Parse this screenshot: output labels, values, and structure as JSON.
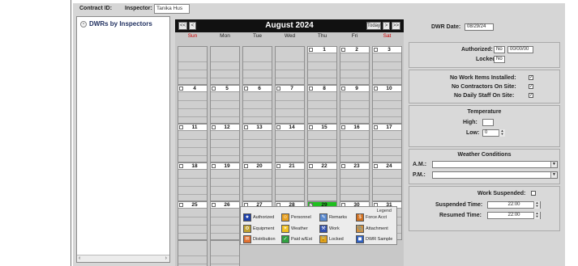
{
  "header": {
    "contract_label": "Contract ID:",
    "inspector_label": "Inspector:",
    "inspector_value": "Tanika Hus"
  },
  "tree": {
    "item_label": "DWRs by Inspectors",
    "toggle": "-"
  },
  "calendar": {
    "title": "August 2024",
    "prev_year": "<<",
    "prev_month": "<",
    "today": "Today",
    "next_month": ">",
    "next_year": ">>",
    "weekdays": [
      "Sun",
      "Mon",
      "Tue",
      "Wed",
      "Thu",
      "Fri",
      "Sat"
    ],
    "weeks": [
      [
        "",
        "",
        "",
        "",
        "1",
        "2",
        "3"
      ],
      [
        "4",
        "5",
        "6",
        "7",
        "8",
        "9",
        "10"
      ],
      [
        "11",
        "12",
        "13",
        "14",
        "15",
        "16",
        "17"
      ],
      [
        "18",
        "19",
        "20",
        "21",
        "22",
        "23",
        "24"
      ],
      [
        "25",
        "26",
        "27",
        "28",
        "29",
        "30",
        "31"
      ],
      [
        "",
        "",
        "",
        "",
        "",
        "",
        ""
      ]
    ],
    "selected_day": "29",
    "checkmark": "✓"
  },
  "legend": {
    "title": "Legend",
    "items": [
      {
        "label": "Authorized",
        "icon": "authorized-icon",
        "color": "#1c3fa8"
      },
      {
        "label": "Personnel",
        "icon": "personnel-icon",
        "color": "#e8a020"
      },
      {
        "label": "Remarks",
        "icon": "remarks-icon",
        "color": "#5a8ad0"
      },
      {
        "label": "Force Acct",
        "icon": "force-acct-icon",
        "color": "#d07020"
      },
      {
        "label": "Equipment",
        "icon": "equipment-icon",
        "color": "#c0a030"
      },
      {
        "label": "Weather",
        "icon": "weather-icon",
        "color": "#f0c020"
      },
      {
        "label": "Work",
        "icon": "work-icon",
        "color": "#3050b0"
      },
      {
        "label": "Attachment",
        "icon": "attachment-icon",
        "color": "#d09040"
      },
      {
        "label": "Distribution",
        "icon": "distribution-icon",
        "color": "#e07030"
      },
      {
        "label": "Paid w/Est",
        "icon": "paid-icon",
        "color": "#30a040"
      },
      {
        "label": "Locked",
        "icon": "lock-icon",
        "color": "#e0a020"
      },
      {
        "label": "DWR Sample",
        "icon": "sample-icon",
        "color": "#3060c0"
      }
    ]
  },
  "panel": {
    "dwr_date_label": "DWR Date:",
    "dwr_date_value": "08/29/24",
    "authorized_label": "Authorized:",
    "authorized_value": "No",
    "authorized_date": "00/00/00",
    "locked_label": "Locked:",
    "locked_value": "No",
    "no_work_label": "No Work Items Installed:",
    "no_contractors_label": "No Contractors On Site:",
    "no_daily_staff_label": "No Daily Staff On Site:",
    "temperature_title": "Temperature",
    "high_label": "High:",
    "high_value": "",
    "low_label": "Low:",
    "low_value": "0",
    "weather_title": "Weather Conditions",
    "am_label": "A.M.:",
    "pm_label": "P.M.:",
    "work_suspended_label": "Work Suspended:",
    "suspended_time_label": "Suspended Time:",
    "suspended_time_value": "22:00",
    "resumed_time_label": "Resumed Time:",
    "resumed_time_value": "22:00"
  }
}
